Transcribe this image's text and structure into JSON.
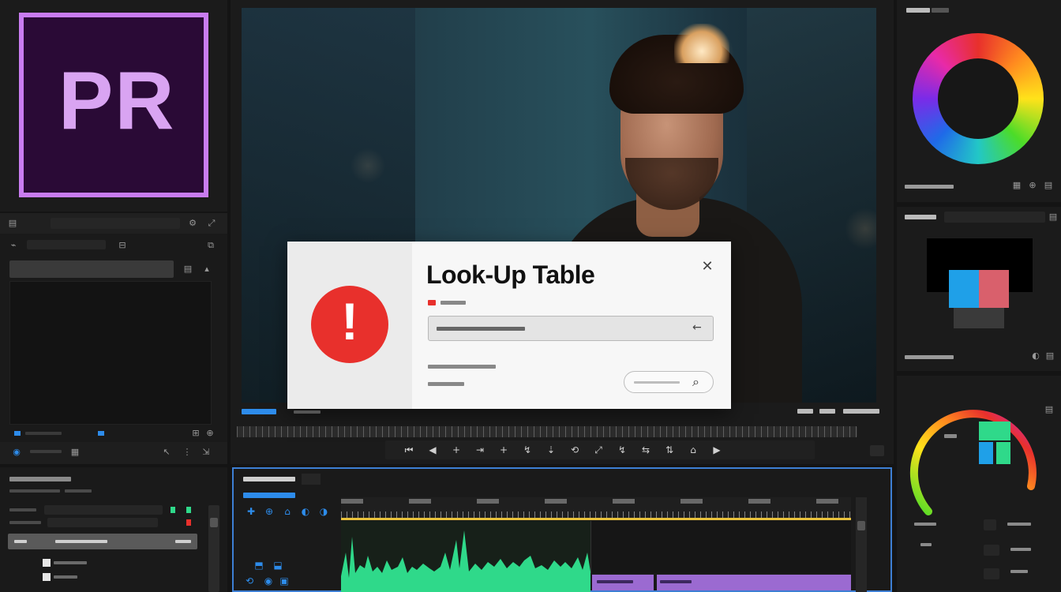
{
  "logo": {
    "text": "PR",
    "bg": "#2a0a36",
    "border": "#c97cf0"
  },
  "dialog": {
    "title": "Look-Up Table",
    "close_glyph": "✕",
    "alert_glyph": "!",
    "back_glyph": "←",
    "search_glyph": "⌕",
    "accent": "#e8302c"
  },
  "playback": {
    "transport_glyphs": [
      "⏮",
      "◀",
      "+",
      "⇥",
      "+",
      "↯",
      "⇣",
      "⟲",
      "⤢",
      "↯",
      "⇆",
      "⇅",
      "⌂",
      "▶"
    ]
  },
  "timeline": {
    "tool_glyphs": [
      "✚",
      "⊕",
      "⌂",
      "◐",
      "◑"
    ]
  },
  "colors": {
    "accent_blue": "#2d8ceb",
    "waveform": "#2fd98a",
    "clip": "#9b6ad1",
    "playhead": "#e8c13b",
    "panel_border": "#3d7fd4"
  }
}
